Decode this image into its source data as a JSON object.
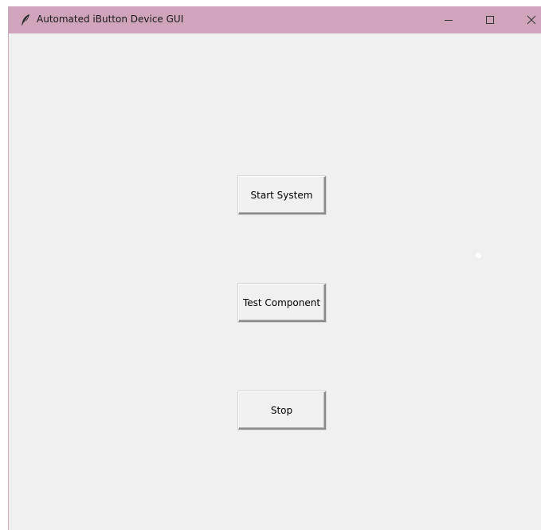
{
  "window": {
    "title": "Automated iButton Device GUI",
    "app_icon": "feather-icon",
    "titlebar_color": "#d0a4bb",
    "controls": [
      "minimize-icon",
      "maximize-icon",
      "close-icon"
    ]
  },
  "main": {
    "background": "#f0f0f0",
    "buttons": {
      "start_label": "Start System",
      "test_label": "Test Component",
      "stop_label": "Stop"
    }
  }
}
